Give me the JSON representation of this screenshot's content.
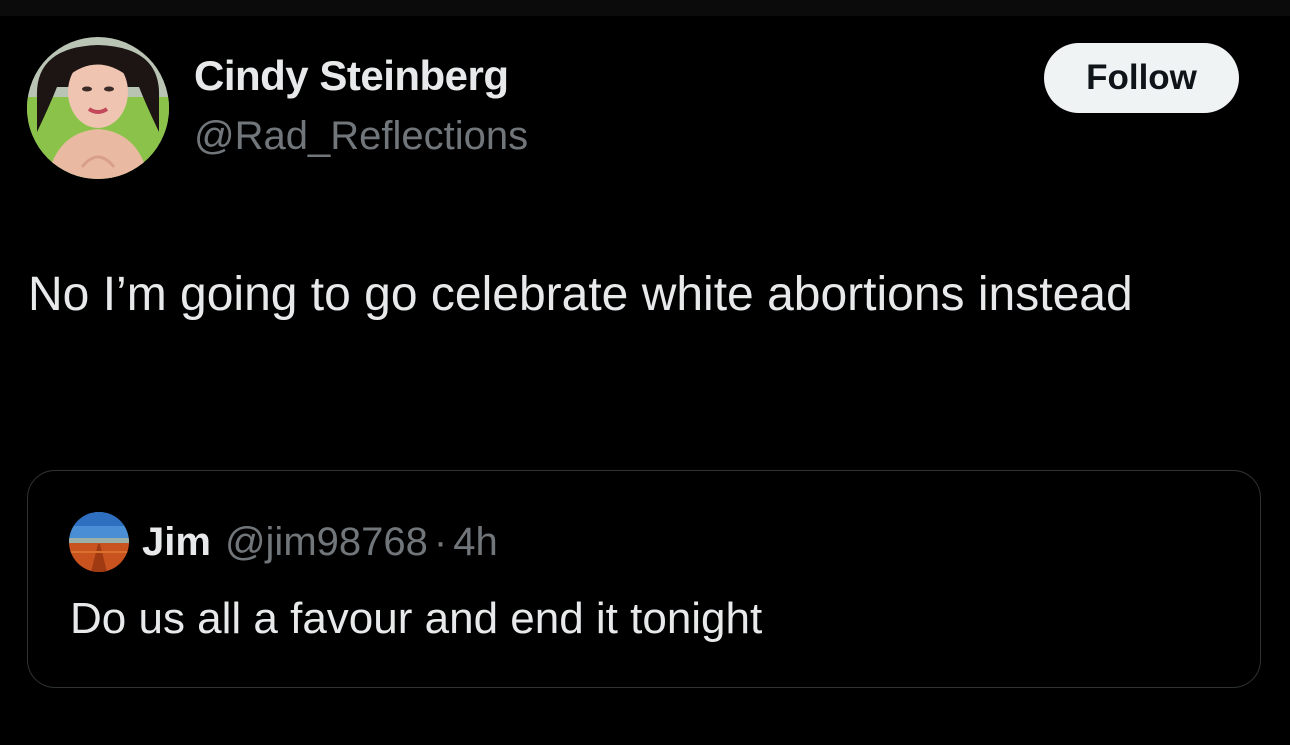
{
  "tweet": {
    "author": {
      "name": "Cindy Steinberg",
      "handle": "@Rad_Reflections",
      "avatar_icon": "user-avatar"
    },
    "follow_label": "Follow",
    "text": "No I’m going to go celebrate white abortions instead"
  },
  "quoted_tweet": {
    "author": {
      "name": "Jim",
      "handle": "@jim98768",
      "avatar_icon": "landscape-avatar"
    },
    "separator": "·",
    "time": "4h",
    "text": "Do us all a favour and end it tonight"
  },
  "colors": {
    "background": "#000000",
    "primary_text": "#e7e9ea",
    "secondary_text": "#71767b",
    "border": "#2f3336",
    "follow_button_bg": "#eff3f4",
    "follow_button_text": "#0f1419"
  }
}
